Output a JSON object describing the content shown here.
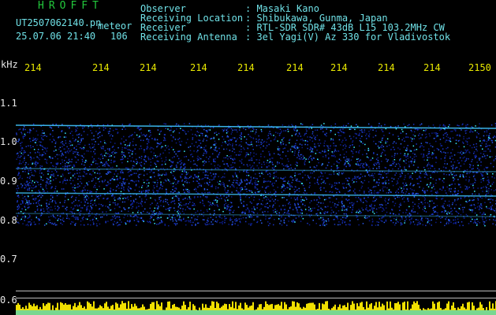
{
  "header": {
    "logo_text": "HROFFT",
    "filename": "UT2507062140.pn",
    "event_label": "meteor",
    "datetime": "25.07.06 21:40",
    "count": "106"
  },
  "info": {
    "rows": [
      {
        "label": "Observer",
        "value": ": Masaki Kano"
      },
      {
        "label": "Receiving Location",
        "value": ": Shibukawa, Gunma, Japan"
      },
      {
        "label": "Receiver",
        "value": ": RTL-SDR SDR# 43dB L15 103.2MHz CW"
      },
      {
        "label": "Receiving Antenna",
        "value": ": 3el Yagi(V) Az 330 for Vladivostok"
      }
    ]
  },
  "freq_axis": {
    "labels": [
      "214",
      "214",
      "214",
      "214",
      "214",
      "214",
      "214",
      "214",
      "214",
      "2150"
    ]
  },
  "y_axis": {
    "unit": "kHz",
    "labels": [
      "1.1",
      "1.0",
      "0.9",
      "0.8",
      "0.7",
      "0.6"
    ]
  },
  "colors": {
    "background": "#000000",
    "spectrum_low": "#0a1a8c",
    "spectrum_high": "#3cf0ff",
    "trace": "#f0e000",
    "logo": "#22c83c",
    "label": "#6fe0e6",
    "tick": "#e8e800"
  }
}
